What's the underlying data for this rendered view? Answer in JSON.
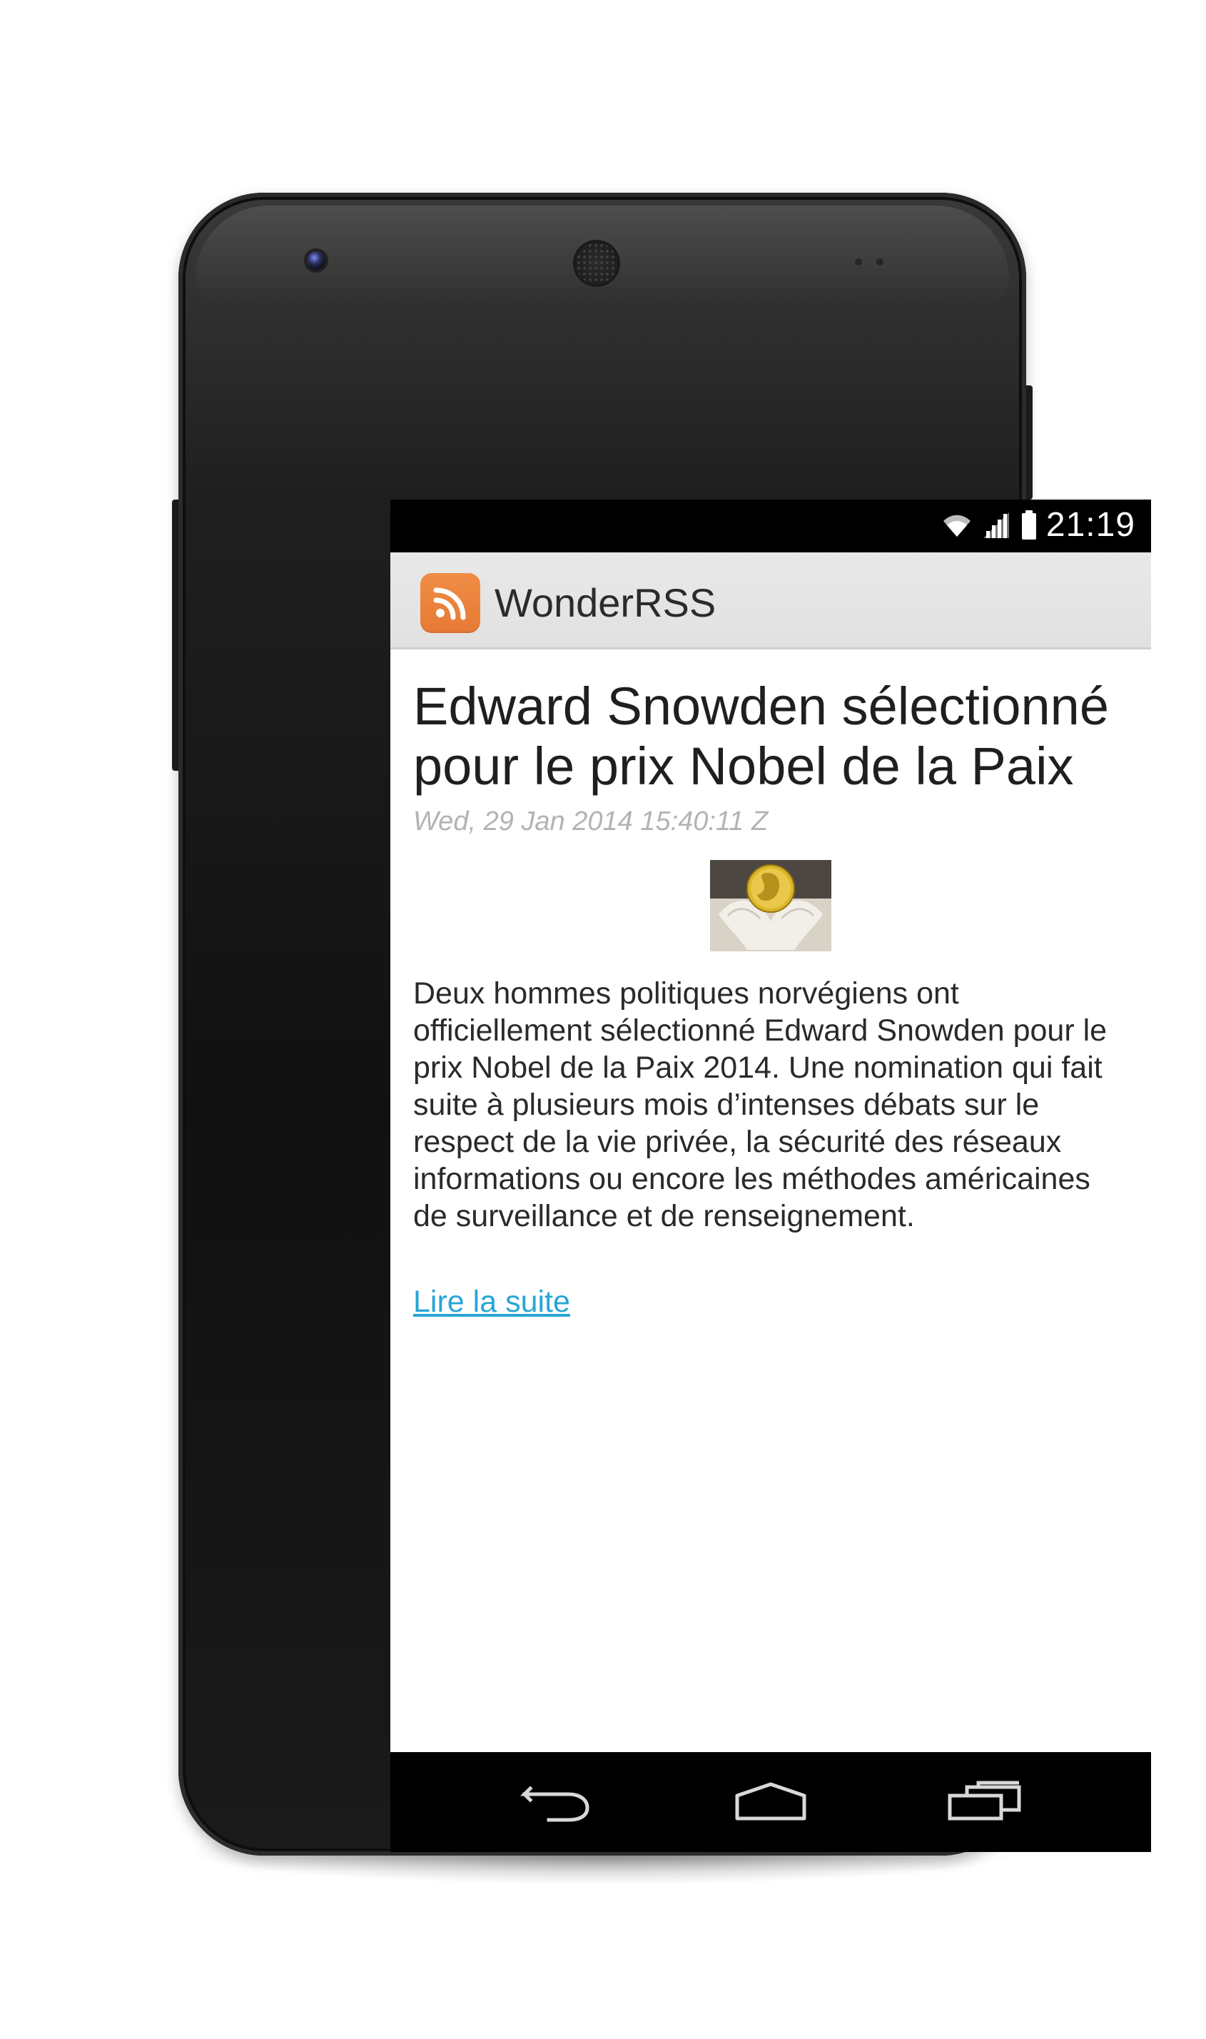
{
  "status_bar": {
    "time": "21:19",
    "icons": [
      "wifi-icon",
      "signal-icon",
      "battery-icon"
    ]
  },
  "app": {
    "name": "WonderRSS",
    "logo_icon": "rss-icon",
    "logo_color": "#EB833B"
  },
  "article": {
    "title": "Edward Snowden sélectionné pour le prix Nobel de la Paix",
    "date": "Wed, 29 Jan 2014 15:40:11 Z",
    "image_icon": "nobel-medal-image",
    "body": "Deux hommes politiques norvégiens ont\nofficiellement sélectionné Edward Snowden pour le\nprix Nobel de la Paix 2014. Une nomination qui fait\nsuite à plusieurs mois d’intenses débats sur le\nrespect de la vie privée, la sécurité des réseaux\ninformations ou encore les méthodes américaines\nde surveillance et de renseignement.",
    "read_more": "Lire la suite",
    "link_color": "#27A6D6"
  },
  "navigation": {
    "buttons": [
      "back-icon",
      "home-icon",
      "recent-apps-icon"
    ]
  }
}
